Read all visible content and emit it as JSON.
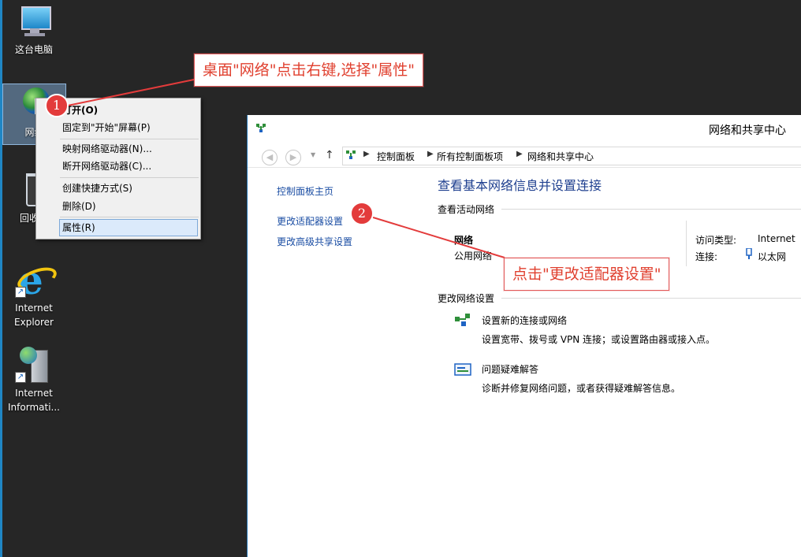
{
  "desktop": {
    "icons": {
      "this_pc": "这台电脑",
      "network": "网络",
      "recycle_bin": "回收站",
      "ie": [
        "Internet",
        "Explorer"
      ],
      "iis": [
        "Internet",
        "Informati..."
      ]
    }
  },
  "context_menu": {
    "items": [
      "打开(O)",
      "固定到\"开始\"屏幕(P)",
      "映射网络驱动器(N)...",
      "断开网络驱动器(C)...",
      "创建快捷方式(S)",
      "删除(D)",
      "属性(R)"
    ],
    "highlighted": "属性(R)"
  },
  "annotations": {
    "callout1": "桌面\"网络\"点击右键,选择\"属性\"",
    "callout2": "点击\"更改适配器设置\"",
    "badge1": "1",
    "badge2": "2",
    "accent_color": "#e33b3b"
  },
  "window": {
    "title": "网络和共享中心",
    "breadcrumb": [
      "控制面板",
      "所有控制面板项",
      "网络和共享中心"
    ],
    "sidebar": {
      "links": [
        "控制面板主页",
        "更改适配器设置",
        "更改高级共享设置"
      ]
    },
    "main": {
      "heading": "查看基本网络信息并设置连接",
      "active_networks_title": "查看活动网络",
      "network_name": "网络",
      "network_type": "公用网络",
      "access_type_label": "访问类型:",
      "access_type_value": "Internet",
      "connection_label": "连接:",
      "connection_value": "以太网",
      "change_settings_title": "更改网络设置",
      "tasks": [
        {
          "link": "设置新的连接或网络",
          "desc": "设置宽带、拨号或 VPN 连接；或设置路由器或接入点。",
          "icon": "new-connection-icon"
        },
        {
          "link": "问题疑难解答",
          "desc": "诊断并修复网络问题，或者获得疑难解答信息。",
          "icon": "troubleshoot-icon"
        }
      ]
    }
  }
}
